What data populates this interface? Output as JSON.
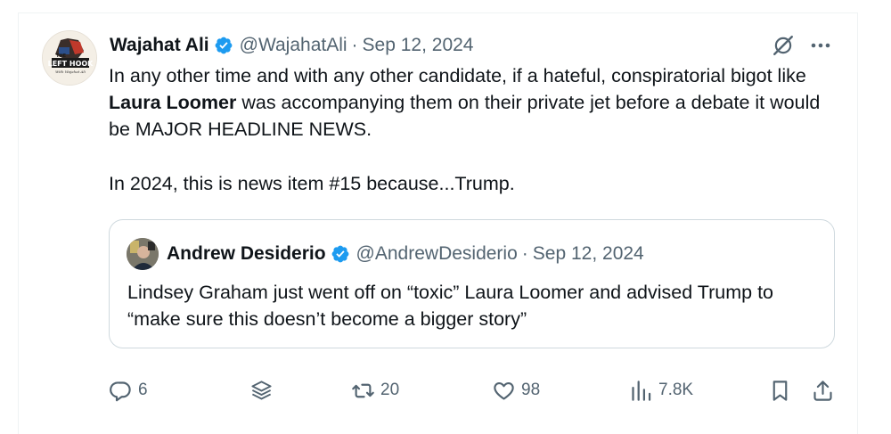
{
  "tweet": {
    "author_name": "Wajahat Ali",
    "handle": "@WajahatAli",
    "separator": "·",
    "date": "Sep 12, 2024",
    "avatar_text_top": "THE",
    "avatar_text_main": "LEFT HOOK",
    "avatar_text_sub": "With Wajahat Ali",
    "text_line1_pre": "In any other time and with any other candidate, if a hateful, conspiratorial bigot like ",
    "mention": "Laura Loomer",
    "text_line1_post": " was accompanying them on their private jet before a debate it would be MAJOR HEADLINE NEWS.",
    "text_line2": "In 2024, this is news item #15 because...Trump."
  },
  "quote": {
    "author_name": "Andrew Desiderio",
    "handle": "@AndrewDesiderio",
    "separator": "·",
    "date": "Sep 12, 2024",
    "text": "Lindsey Graham just went off on “toxic” Laura Loomer and advised Trump to “make sure this doesn’t become a bigger story”"
  },
  "actions": {
    "replies": "6",
    "reposts": "20",
    "likes": "98",
    "views": "7.8K"
  },
  "colors": {
    "verified": "#1d9bf0",
    "secondary_text": "#536471",
    "border": "#cfd9de"
  },
  "icons": [
    "verified-badge-icon",
    "grok-icon",
    "more-icon",
    "reply-icon",
    "layers-icon",
    "repost-icon",
    "like-icon",
    "views-icon",
    "bookmark-icon",
    "share-icon"
  ]
}
